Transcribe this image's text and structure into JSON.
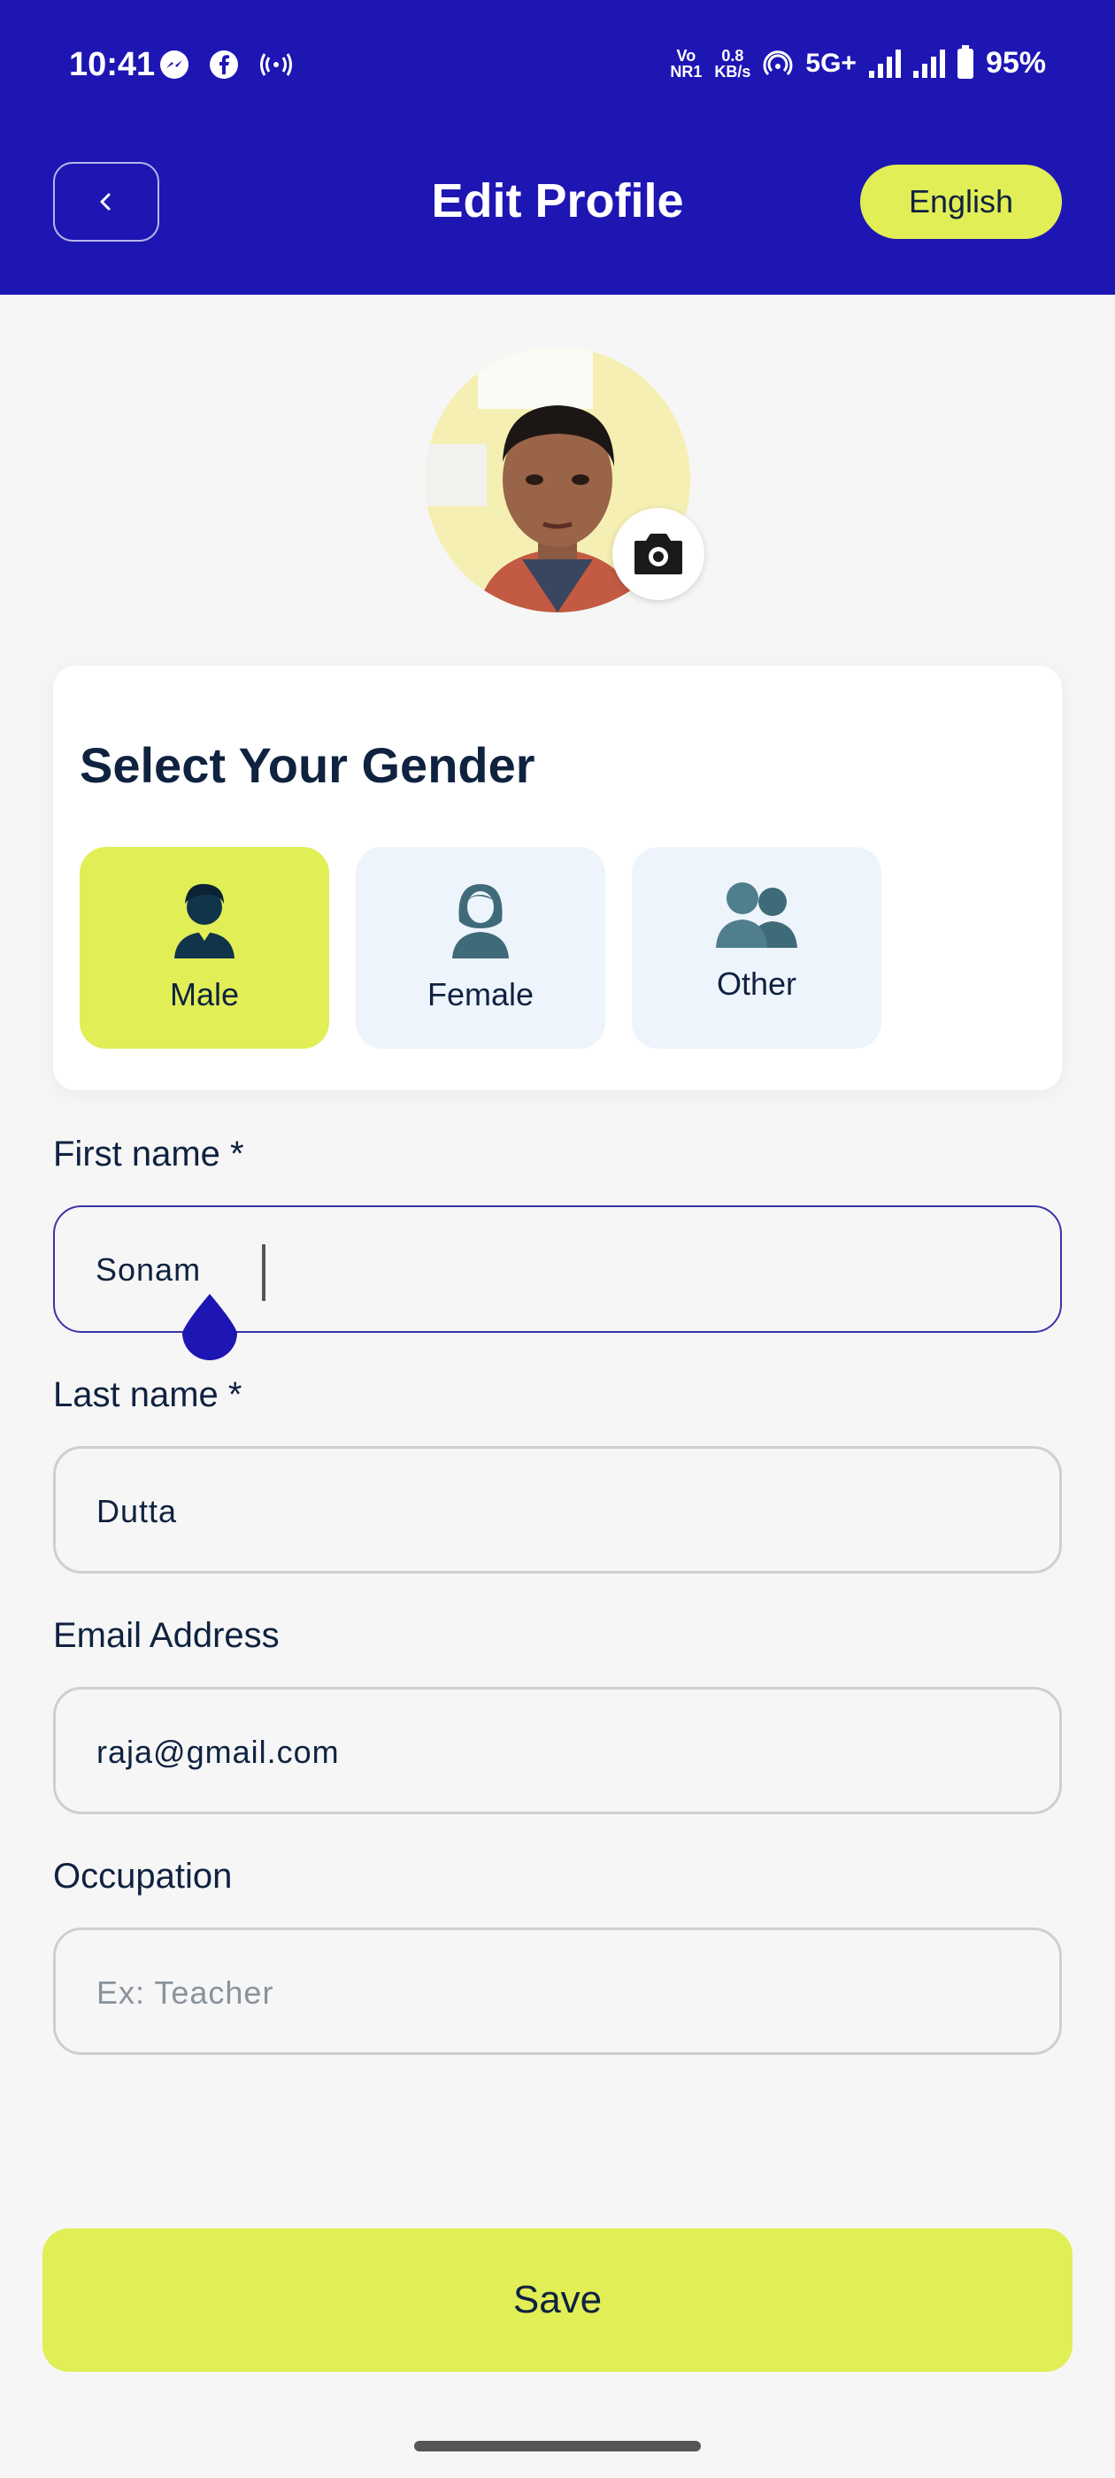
{
  "status_bar": {
    "time": "10:41",
    "network_top": "Vo",
    "network_bottom": "NR1",
    "speed_value": "0.8",
    "speed_unit": "KB/s",
    "net_type": "5G+",
    "battery": "95%",
    "icons_left": [
      "messenger-icon",
      "facebook-icon",
      "hotspot-icon"
    ],
    "icons_right": [
      "hotspot-signal-icon",
      "signal-icon",
      "signal-icon",
      "battery-icon"
    ]
  },
  "header": {
    "title": "Edit Profile",
    "language": "English",
    "back_icon": "chevron-left-icon"
  },
  "avatar": {
    "camera_icon": "camera-icon"
  },
  "gender": {
    "title": "Select Your Gender",
    "options": [
      {
        "label": "Male",
        "icon": "male-person-icon",
        "selected": true
      },
      {
        "label": "Female",
        "icon": "female-person-icon",
        "selected": false
      },
      {
        "label": "Other",
        "icon": "group-people-icon",
        "selected": false
      }
    ]
  },
  "form": {
    "first_name": {
      "label": "First name *",
      "value": "Sonam"
    },
    "last_name": {
      "label": "Last name *",
      "value": "Dutta"
    },
    "email": {
      "label": "Email Address",
      "value": "raja@gmail.com"
    },
    "occupation": {
      "label": "Occupation",
      "value": "",
      "placeholder": "Ex: Teacher"
    }
  },
  "save_label": "Save",
  "colors": {
    "primary": "#1e16b3",
    "accent": "#e1ee55",
    "text_dark": "#0f2240",
    "icon_teal": "#3f6b79"
  }
}
